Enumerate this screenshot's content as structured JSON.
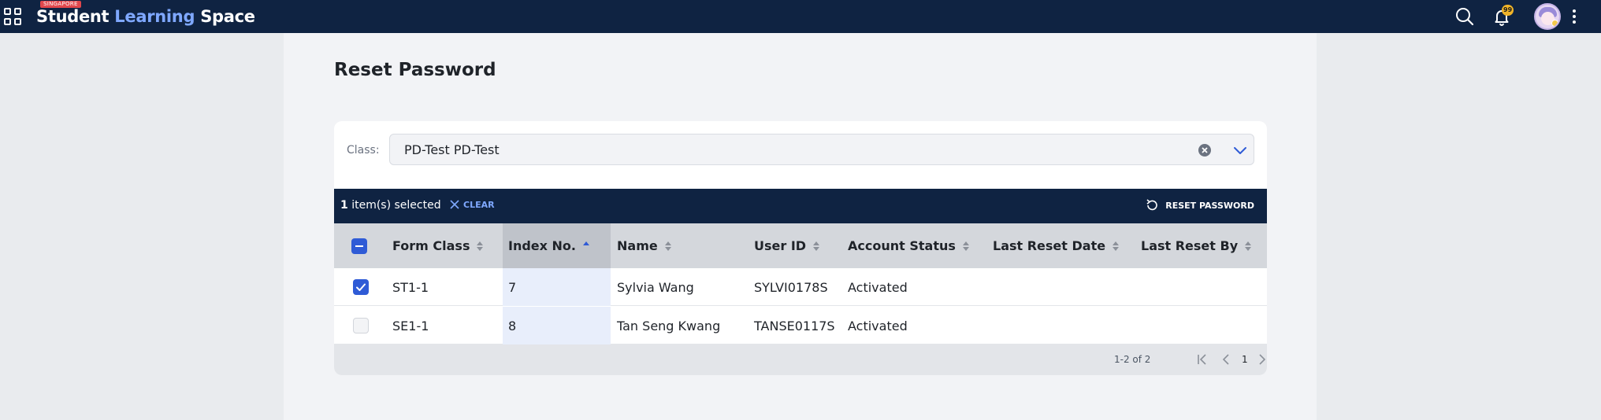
{
  "header": {
    "brand_tag": "SINGAPORE",
    "brand_word1": "Student",
    "brand_word2": "Learning",
    "brand_word3": "Space",
    "notification_count": "99"
  },
  "page": {
    "title": "Reset Password"
  },
  "filter": {
    "label": "Class:",
    "value": "PD-Test PD-Test"
  },
  "action_bar": {
    "selected_count": "1",
    "selected_suffix": " item(s) selected",
    "clear_label": "CLEAR",
    "reset_label": "RESET PASSWORD"
  },
  "table": {
    "columns": [
      "Form Class",
      "Index No.",
      "Name",
      "User ID",
      "Account Status",
      "Last Reset Date",
      "Last Reset By"
    ],
    "sorted_column": "Index No.",
    "rows": [
      {
        "checked": true,
        "form_class": "ST1-1",
        "index_no": "7",
        "name": "Sylvia Wang",
        "user_id": "SYLVI0178S",
        "status": "Activated",
        "last_reset_date": "",
        "last_reset_by": ""
      },
      {
        "checked": false,
        "form_class": "SE1-1",
        "index_no": "8",
        "name": "Tan Seng Kwang",
        "user_id": "TANSE0117S",
        "status": "Activated",
        "last_reset_date": "",
        "last_reset_by": ""
      }
    ]
  },
  "pagination": {
    "range": "1-2 of 2",
    "page": "1"
  },
  "colors": {
    "navy": "#0f2342",
    "accent_blue": "#2f5bd6",
    "link_blue": "#7fa8ff",
    "badge_yellow": "#f0b429"
  }
}
